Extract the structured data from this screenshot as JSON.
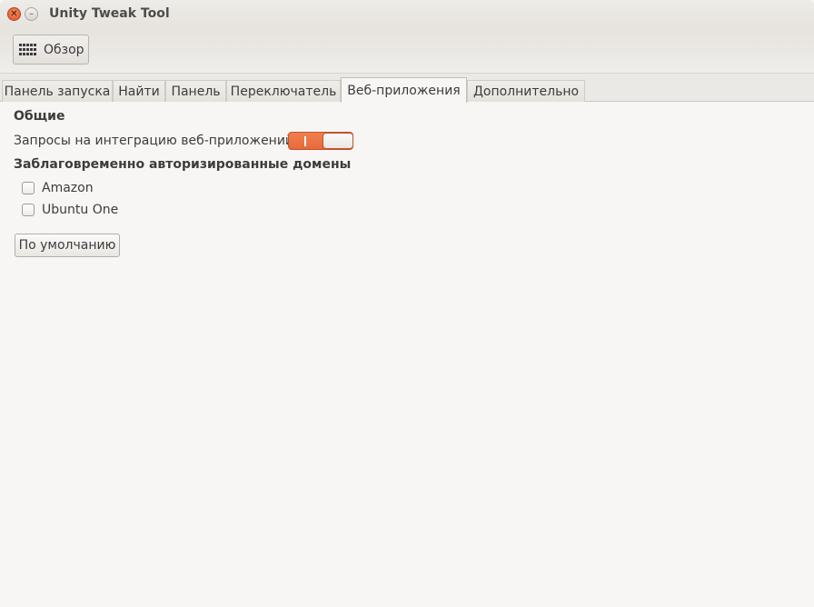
{
  "window": {
    "title": "Unity Tweak Tool",
    "close_glyph": "✕",
    "minimize_glyph": "–"
  },
  "toolbar": {
    "overview_label": "Обзор",
    "overview_icon": "grid-icon"
  },
  "tabs": [
    {
      "label": "Панель запуска",
      "active": false
    },
    {
      "label": "Найти",
      "active": false
    },
    {
      "label": "Панель",
      "active": false
    },
    {
      "label": "Переключатель",
      "active": false
    },
    {
      "label": "Веб-приложения",
      "active": true
    },
    {
      "label": "Дополнительно",
      "active": false
    }
  ],
  "general": {
    "heading": "Общие",
    "integration_label": "Запросы на интеграцию веб-приложений:",
    "integration_enabled": true
  },
  "domains": {
    "heading": "Заблаговременно авторизированные домены",
    "items": [
      {
        "label": "Amazon",
        "checked": false
      },
      {
        "label": "Ubuntu One",
        "checked": false
      }
    ]
  },
  "defaults_button": "По умолчанию",
  "colors": {
    "accent": "#e9723f",
    "window_bg": "#f7f6f5"
  }
}
